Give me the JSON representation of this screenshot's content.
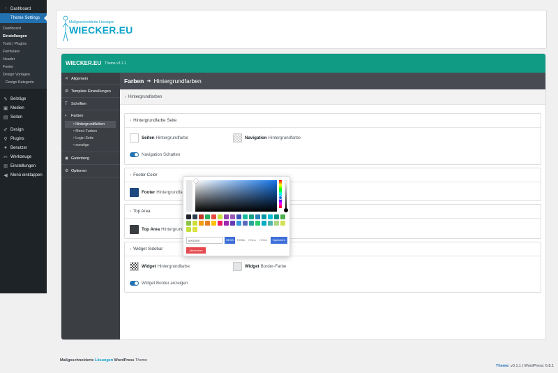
{
  "wp_menu": {
    "dashboard": "Dashboard",
    "theme_settings": "Theme Settings",
    "submenu": [
      "Dashboard",
      "Einstellungen",
      "Tools | Plugins",
      "Formulare",
      "Header",
      "Footer",
      "Design Vorlagen",
      "Design Kategorie"
    ],
    "items": [
      "Beiträge",
      "Medien",
      "Seiten",
      "Design",
      "Plugins",
      "Benutzer",
      "Werkzeuge",
      "Einstellungen",
      "Menü einklappen"
    ]
  },
  "logo": {
    "tagline": "Maßgeschneiderte Lösungen",
    "name": "WIECKER.EU"
  },
  "topbar": {
    "brand": "WIECKER.EU",
    "version": "Theme v3.1.1"
  },
  "settings_nav": {
    "items": [
      "Allgemein",
      "Template Einstellungen",
      "Schriften",
      "Farben",
      "Gutenberg",
      "Optionen"
    ],
    "farben_subs": [
      "Hintergrundfarben",
      "Menü Farben",
      "Login Seite",
      "sonstige"
    ]
  },
  "breadcrumb": {
    "section": "Farben",
    "page": "Hintergrundfarben"
  },
  "section_title": "Hintergrundfarben",
  "panels": {
    "seite": {
      "title": "Hintergrundfarbe Seite",
      "seiten_bold": "Seiten",
      "seiten_text": "Hintergrundfarbe",
      "nav_bold": "Navigation",
      "nav_text": "Hintergrundfarbe",
      "toggle_label": "Navigation Schatten"
    },
    "footer": {
      "title": "Footer Color",
      "bold": "Footer",
      "text": "Hintergrundfarbe"
    },
    "top": {
      "title": "Top Area",
      "bold": "Top Area",
      "text": "Hintergrundfarbe"
    },
    "widget": {
      "title": "Widget Sidebar",
      "w_bold": "Widget",
      "w_text": "Hintergrundfarbe",
      "b_bold": "Widget",
      "b_text": "Border-Farbe",
      "toggle_label": "Widget Border anzeigen"
    }
  },
  "picker": {
    "hex_value": "#0062B9",
    "modes": [
      "HEXA",
      "RGBA",
      "HSLA",
      "HSVA"
    ],
    "active_mode": "HEXA",
    "save": "Speichern",
    "cancel": "Abbrechen",
    "swatches": [
      "#20232a",
      "#2c3e50",
      "#c0392b",
      "#27ae60",
      "#e74c3c",
      "#c2e33f",
      "#8e44ad",
      "#9b59b6",
      "#3f51b5",
      "#1abc9c",
      "#16a085",
      "#2980b9",
      "#0097a7",
      "#00bcd4",
      "#009688",
      "#4caf50",
      "#8bc34a",
      "#cddc39",
      "#f39c12",
      "#e67e22",
      "#ffc107",
      "#e91e63",
      "#9c27b0",
      "#673ab7",
      "#3498db",
      "#5c6bc0",
      "#26a69a",
      "#2ecc71",
      "#00acc1",
      "#4db6ac",
      "#aed581",
      "#d4e157",
      "#c6e03b",
      "#dce23d"
    ]
  },
  "footer": {
    "left_prefix": "Maßgeschneiderte",
    "left_accent": "Lösungen",
    "left_brand": "WordPress",
    "left_suffix": "Theme",
    "right_theme_label": "Theme:",
    "right_theme_ver": "v3.1.1",
    "right_wp": "WordPress: 6.8.1"
  }
}
